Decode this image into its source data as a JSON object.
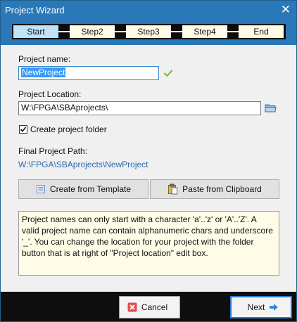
{
  "window": {
    "title": "Project Wizard",
    "close_glyph": "✕"
  },
  "steps": [
    {
      "label": "Start",
      "active": true
    },
    {
      "label": "Step2",
      "active": false
    },
    {
      "label": "Step3",
      "active": false
    },
    {
      "label": "Step4",
      "active": false
    },
    {
      "label": "End",
      "active": false
    }
  ],
  "form": {
    "project_name_label": "Project name:",
    "project_name_value": "NewProject",
    "project_location_label": "Project Location:",
    "project_location_value": "W:\\FPGA\\SBAprojects\\",
    "create_folder_label": "Create project folder",
    "create_folder_checked": true,
    "final_path_label": "Final Project Path:",
    "final_path_value": "W:\\FPGA\\SBAprojects\\NewProject"
  },
  "buttons": {
    "create_template": "Create from Template",
    "paste_clipboard": "Paste from Clipboard",
    "cancel": "Cancel",
    "next": "Next"
  },
  "info_text": "Project names can only start with a character 'a'..'z' or 'A'..'Z'. A valid project name can contain alphanumeric chars and underscore '_'. You can change the location for your project with the folder button that is at right of \"Project location\" edit box.",
  "icons": {
    "valid": "checkmark-icon",
    "browse": "folder-icon",
    "template": "template-icon",
    "clipboard": "clipboard-icon",
    "cancel": "cancel-icon",
    "next": "arrow-right-icon"
  },
  "colors": {
    "titlebar": "#2b78b8",
    "active_step": "#bfe3fb",
    "inactive_step": "#fffbe6",
    "link": "#2a68b0",
    "valid_check": "#7cc242",
    "cancel_icon": "#e24c4c",
    "next_icon": "#3a86d8"
  }
}
